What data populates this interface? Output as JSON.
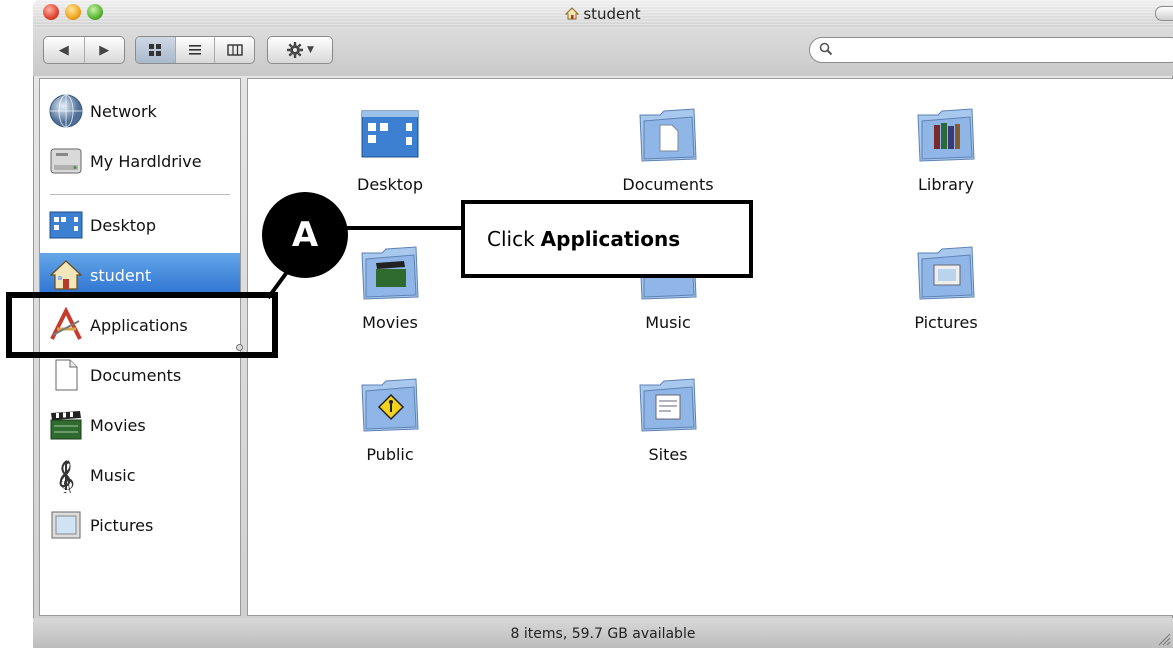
{
  "window": {
    "title": "student"
  },
  "toolbar": {
    "view_modes": [
      "icon",
      "list",
      "column"
    ],
    "selected_view": "icon",
    "search_placeholder": ""
  },
  "sidebar": {
    "items": [
      {
        "label": "Network",
        "icon": "network-globe-icon"
      },
      {
        "label": "My Hardldrive",
        "icon": "hard-drive-icon"
      },
      {
        "label": "Desktop",
        "icon": "desktop-icon"
      },
      {
        "label": "student",
        "icon": "home-icon",
        "selected": true
      },
      {
        "label": "Applications",
        "icon": "applications-icon"
      },
      {
        "label": "Documents",
        "icon": "document-icon"
      },
      {
        "label": "Movies",
        "icon": "clapperboard-icon"
      },
      {
        "label": "Music",
        "icon": "treble-clef-icon"
      },
      {
        "label": "Pictures",
        "icon": "picture-frame-icon"
      }
    ]
  },
  "content": {
    "items": [
      {
        "label": "Desktop",
        "icon": "desktop-folder-icon"
      },
      {
        "label": "Documents",
        "icon": "documents-folder-icon"
      },
      {
        "label": "Library",
        "icon": "library-folder-icon"
      },
      {
        "label": "Movies",
        "icon": "movies-folder-icon"
      },
      {
        "label": "Music",
        "icon": "music-folder-icon"
      },
      {
        "label": "Pictures",
        "icon": "pictures-folder-icon"
      },
      {
        "label": "Public",
        "icon": "public-folder-icon"
      },
      {
        "label": "Sites",
        "icon": "sites-folder-icon"
      }
    ]
  },
  "status": {
    "text": "8 items, 59.7 GB available"
  },
  "annotation": {
    "marker": "A",
    "instruction_prefix": "Click",
    "instruction_target": "Applications"
  },
  "colors": {
    "selection": "#2b71d0",
    "folder_blue": "#8fb6e6"
  }
}
